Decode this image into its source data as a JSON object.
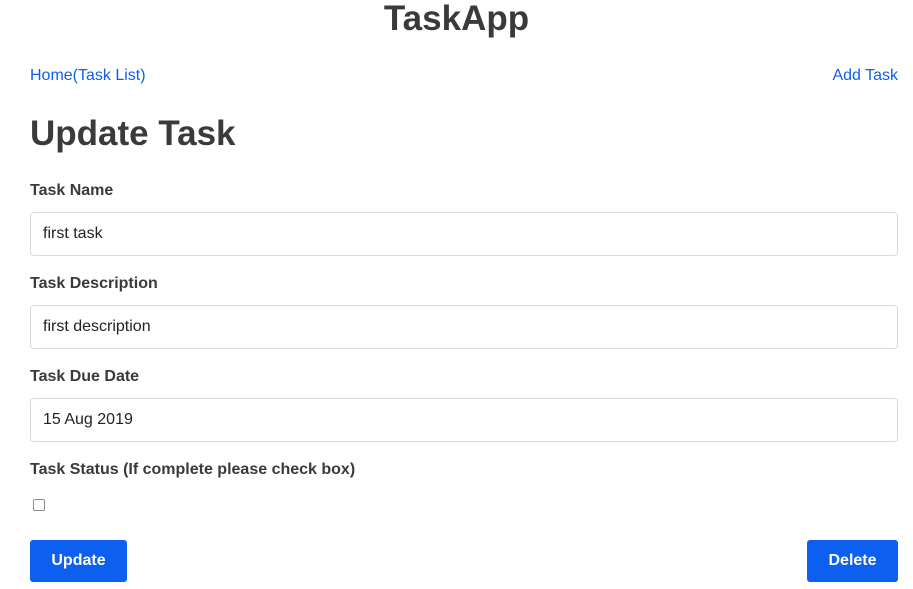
{
  "app": {
    "title": "TaskApp"
  },
  "nav": {
    "home_label": "Home(Task List)",
    "add_task_label": "Add Task"
  },
  "form": {
    "heading": "Update Task",
    "task_name": {
      "label": "Task Name",
      "value": "first task"
    },
    "task_description": {
      "label": "Task Description",
      "value": "first description"
    },
    "task_due_date": {
      "label": "Task Due Date",
      "value": "15 Aug 2019"
    },
    "task_status": {
      "label": "Task Status (If complete please check box)",
      "checked": false
    },
    "update_label": "Update",
    "delete_label": "Delete"
  },
  "colors": {
    "accent": "#0d5ff0",
    "text": "#3a3a3a",
    "border": "#d6d9dd"
  }
}
